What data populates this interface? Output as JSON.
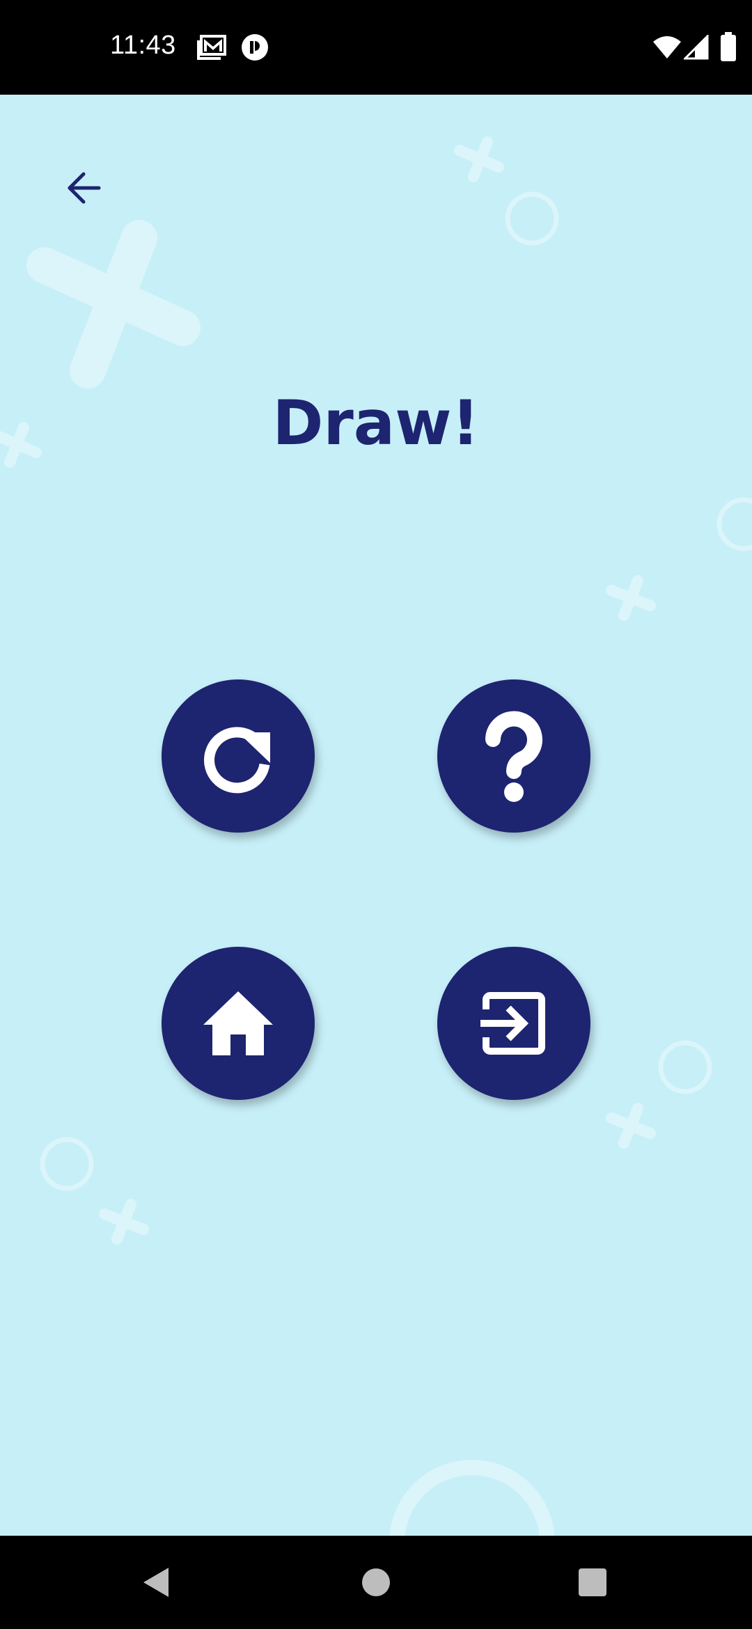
{
  "status_bar": {
    "time": "11:43",
    "left_icons": [
      "gmail-icon",
      "notification-app-icon"
    ],
    "right_icons": [
      "wifi-icon",
      "cellular-signal-icon",
      "battery-icon"
    ]
  },
  "screen": {
    "title": "Draw!",
    "background_color": "#c7eff8",
    "accent_color": "#1d2470",
    "back_icon": "arrow-back-icon"
  },
  "actions": [
    {
      "name": "replay",
      "icon": "redo-icon"
    },
    {
      "name": "help",
      "icon": "question-mark-icon"
    },
    {
      "name": "home",
      "icon": "home-icon"
    },
    {
      "name": "exit",
      "icon": "exit-icon"
    }
  ],
  "nav_bar": {
    "buttons": [
      "back-triangle-icon",
      "home-circle-icon",
      "recents-square-icon"
    ]
  }
}
